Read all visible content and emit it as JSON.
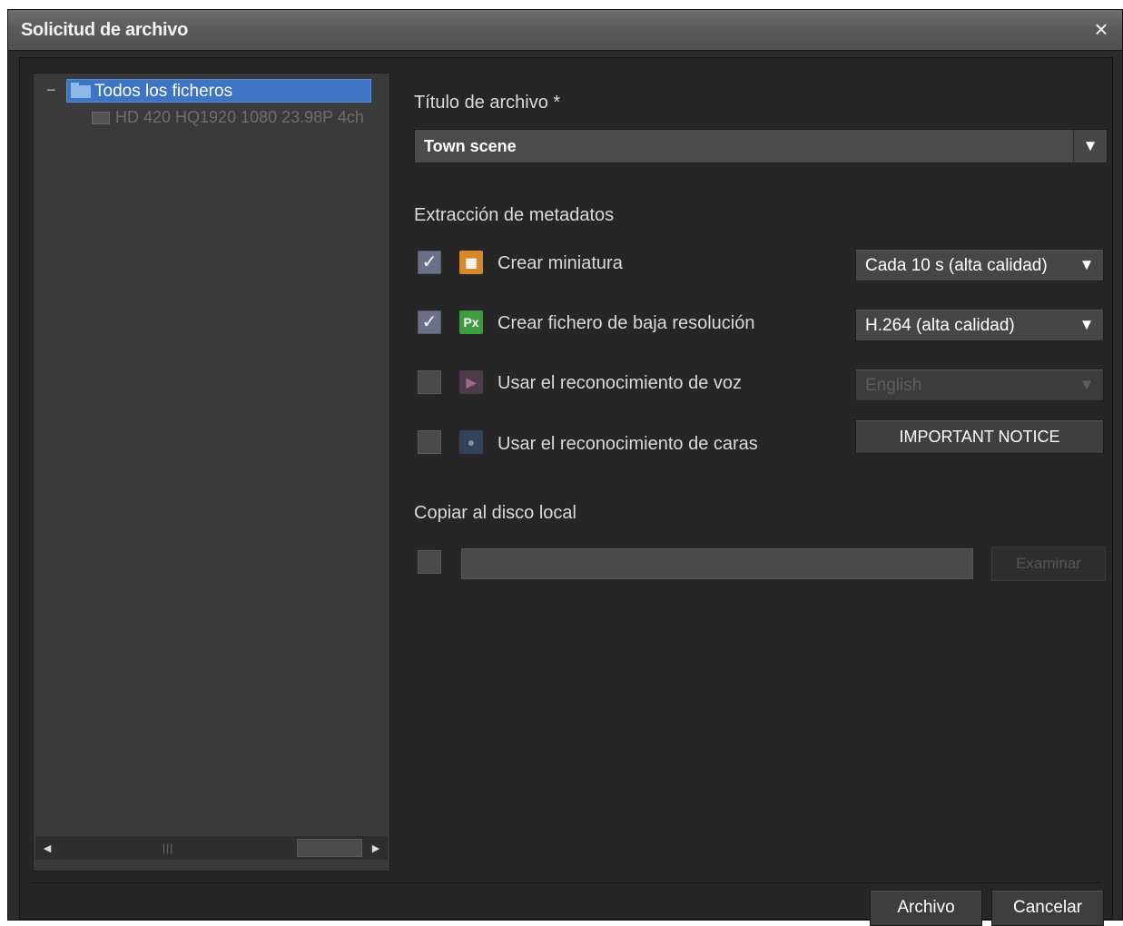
{
  "window": {
    "title": "Solicitud de archivo",
    "close_icon": "×"
  },
  "tree": {
    "toggle": "−",
    "root_label": "Todos los ficheros",
    "child_label": "HD 420 HQ1920 1080 23.98P 4ch",
    "scroll_left": "◄",
    "scroll_right": "►",
    "scroll_grip": "|||"
  },
  "form": {
    "file_title_label": "Título de archivo *",
    "file_title_value": "Town scene",
    "metadata_label": "Extracción de metadatos",
    "options": [
      {
        "label": "Crear miniatura",
        "checked": true,
        "icon": "thumbnail-icon",
        "icon_text": "▦",
        "select_value": "Cada 10 s (alta calidad)"
      },
      {
        "label": "Crear fichero de baja resolución",
        "checked": true,
        "icon": "proxy-icon",
        "icon_text": "Px",
        "select_value": "H.264 (alta calidad)"
      },
      {
        "label": "Usar el reconocimiento de voz",
        "checked": false,
        "icon": "voice-recognition-icon",
        "icon_text": "▶",
        "select_value": "English"
      },
      {
        "label": "Usar el reconocimiento de caras",
        "checked": false,
        "icon": "face-recognition-icon",
        "icon_text": "●",
        "button_label": "IMPORTANT NOTICE"
      }
    ],
    "copy_local_label": "Copiar al disco local",
    "copy_local_checked": false,
    "copy_local_path": "",
    "browse_label": "Examinar"
  },
  "footer": {
    "archive_label": "Archivo",
    "cancel_label": "Cancelar"
  },
  "colors": {
    "selection": "#3d74c4",
    "background": "#262626"
  }
}
